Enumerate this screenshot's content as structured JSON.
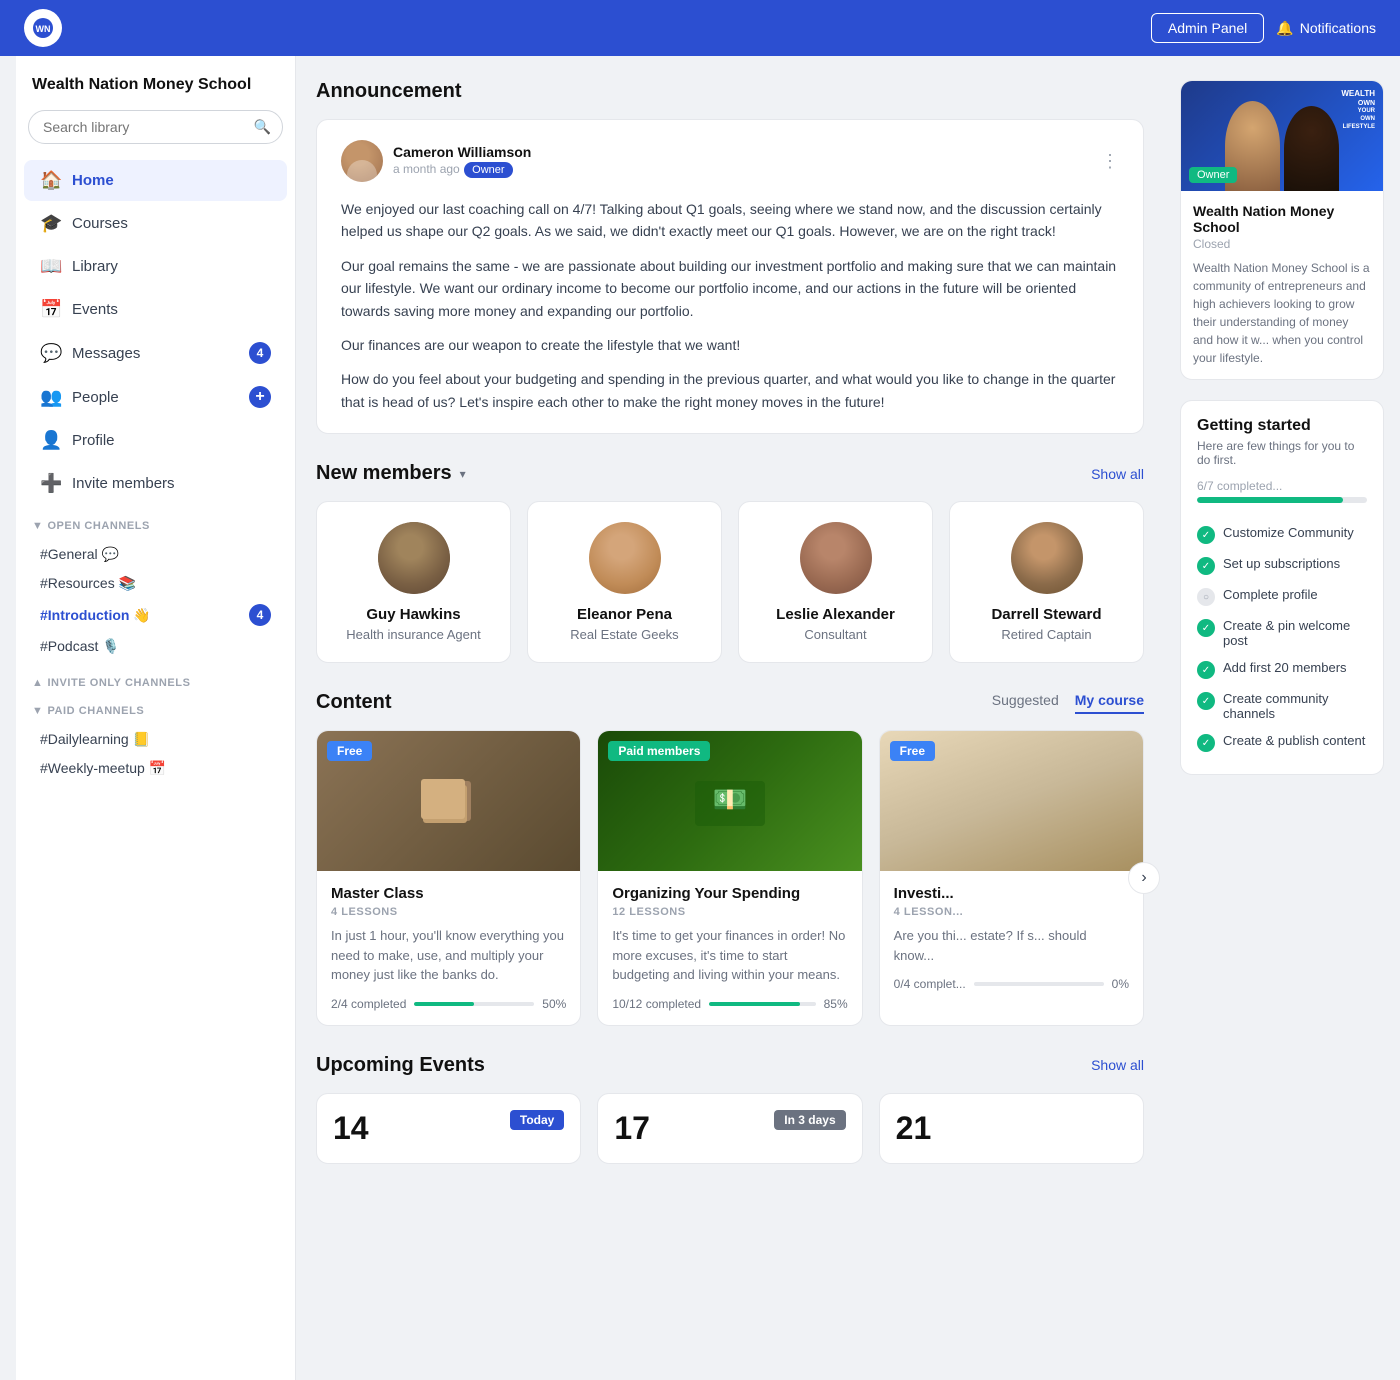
{
  "topnav": {
    "logo_text": "WN",
    "admin_panel_label": "Admin Panel",
    "notifications_label": "Notifications"
  },
  "sidebar": {
    "title": "Wealth Nation Money School",
    "search_placeholder": "Search library",
    "nav_items": [
      {
        "id": "home",
        "label": "Home",
        "icon": "🏠",
        "active": true
      },
      {
        "id": "courses",
        "label": "Courses",
        "icon": "🎓",
        "active": false
      },
      {
        "id": "library",
        "label": "Library",
        "icon": "📖",
        "active": false
      },
      {
        "id": "events",
        "label": "Events",
        "icon": "📅",
        "active": false
      },
      {
        "id": "messages",
        "label": "Messages",
        "icon": "💬",
        "active": false,
        "badge": "4"
      },
      {
        "id": "people",
        "label": "People",
        "icon": "👥",
        "active": false,
        "badge_plus": true
      },
      {
        "id": "profile",
        "label": "Profile",
        "icon": "👤",
        "active": false
      },
      {
        "id": "invite",
        "label": "Invite members",
        "icon": "➕",
        "active": false
      }
    ],
    "open_channels_label": "OPEN CHANNELS",
    "open_channels": [
      {
        "name": "#General 💬",
        "active": false
      },
      {
        "name": "#Resources 📚",
        "active": false
      },
      {
        "name": "#Introduction 👋",
        "active": true,
        "badge": "4"
      },
      {
        "name": "#Podcast 🎙️",
        "active": false
      }
    ],
    "invite_only_label": "INVITE ONLY CHANNELS",
    "paid_channels_label": "PAID CHANNELS",
    "paid_channels": [
      {
        "name": "#Dailylearning 📒",
        "active": false
      },
      {
        "name": "#Weekly-meetup 📅",
        "active": false
      }
    ]
  },
  "announcement": {
    "title": "Announcement",
    "author_name": "Cameron Williamson",
    "author_time": "a month ago",
    "author_role": "Owner",
    "paragraphs": [
      "We enjoyed our last coaching call on 4/7! Talking about Q1 goals, seeing where we stand now, and the discussion certainly helped us shape our Q2 goals. As we said, we didn't exactly meet our Q1 goals. However, we are on the right track!",
      "Our goal remains the same - we are passionate about building our investment portfolio and making sure that we can maintain our lifestyle. We want our ordinary income to become our portfolio income, and our actions in the future will be oriented towards saving more money and expanding our portfolio.",
      "Our finances are our weapon to create the lifestyle that we want!",
      "How do you feel about your budgeting and spending in the previous quarter, and what would you like to change in the quarter that is head of us? Let's inspire each other to make the right money moves in the future!"
    ]
  },
  "new_members": {
    "title": "New members",
    "show_all_label": "Show all",
    "members": [
      {
        "name": "Guy Hawkins",
        "role": "Health insurance Agent",
        "avatar_id": "guy"
      },
      {
        "name": "Eleanor Pena",
        "role": "Real Estate Geeks",
        "avatar_id": "eleanor"
      },
      {
        "name": "Leslie Alexander",
        "role": "Consultant",
        "avatar_id": "leslie"
      },
      {
        "name": "Darrell Steward",
        "role": "Retired Captain",
        "avatar_id": "darrell"
      }
    ]
  },
  "content": {
    "title": "Content",
    "tab_suggested": "Suggested",
    "tab_my_course": "My course",
    "active_tab": "my_course",
    "cards": [
      {
        "badge": "Free",
        "badge_type": "free",
        "title": "Master Class",
        "lessons": "4 LESSONS",
        "desc": "In just 1 hour, you'll know everything you need to make, use, and multiply your money just like the banks do.",
        "progress_text": "2/4 completed",
        "progress_pct": 50,
        "thumb_class": "thumb-books"
      },
      {
        "badge": "Paid members",
        "badge_type": "paid",
        "title": "Organizing Your Spending",
        "lessons": "12 LESSONS",
        "desc": "It's time to get your finances in order! No more excuses, it's time to start budgeting and living within your means.",
        "progress_text": "10/12 completed",
        "progress_pct": 85,
        "thumb_class": "thumb-money"
      },
      {
        "badge": "Free",
        "badge_type": "free",
        "title": "Investi...",
        "lessons": "4 LESSON...",
        "desc": "Are you thi... estate? If s... should know...",
        "progress_text": "0/4 complet...",
        "progress_pct": 0,
        "thumb_class": "thumb-bedroom"
      }
    ]
  },
  "upcoming_events": {
    "title": "Upcoming Events",
    "show_all_label": "Show all",
    "events": [
      {
        "date": "14",
        "badge": "Today",
        "badge_type": "today"
      },
      {
        "date": "17",
        "badge": "In 3 days",
        "badge_type": "days"
      },
      {
        "date": "21",
        "badge": "",
        "badge_type": "none"
      }
    ]
  },
  "right_sidebar": {
    "community": {
      "owner_label": "Owner",
      "name": "Wealth Nation Money School",
      "status": "Closed",
      "desc": "Wealth Nation Money School is a community of entrepreneurs and high achievers looking to grow their understanding of money and how it w... when you control your lifestyle."
    },
    "getting_started": {
      "title": "Getting started",
      "subtitle": "Here are few things for you to do first.",
      "progress_label": "6/7 completed...",
      "progress_pct": 86,
      "items": [
        {
          "label": "Customize Community",
          "done": true
        },
        {
          "label": "Set up subscriptions",
          "done": true
        },
        {
          "label": "Complete profile",
          "done": false
        },
        {
          "label": "Create & pin welcome post",
          "done": true
        },
        {
          "label": "Add first 20 members",
          "done": true
        },
        {
          "label": "Create community channels",
          "done": true
        },
        {
          "label": "Create & publish content",
          "done": true
        }
      ]
    }
  }
}
